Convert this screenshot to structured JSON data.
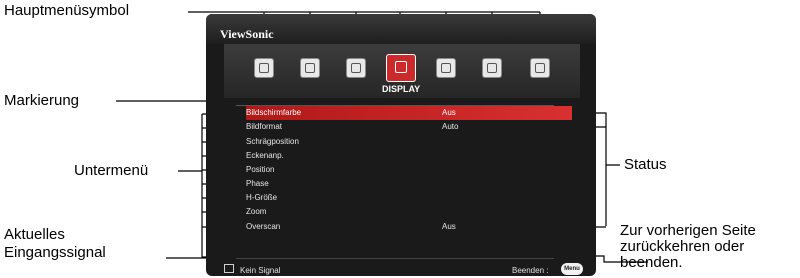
{
  "annotations": {
    "main_icon": "Hauptmenüsymbol",
    "highlight": "Markierung",
    "submenu": "Untermenü",
    "current_input_line1": "Aktuelles",
    "current_input_line2": "Eingangssignal",
    "status": "Status",
    "back_line1": "Zur vorherigen Seite",
    "back_line2": "zurückkehren oder",
    "back_line3": "beenden."
  },
  "osd": {
    "brand": "ViewSonic",
    "category": "DISPLAY",
    "icons": [
      "picture-icon",
      "color-icon",
      "lamp-icon",
      "display-icon",
      "settings-icon",
      "system-icon",
      "info-icon"
    ],
    "active_icon_index": 3,
    "items": [
      {
        "label": "Bildschirmfarbe",
        "value": "Aus"
      },
      {
        "label": "Bildformat",
        "value": "Auto"
      },
      {
        "label": "Schrägposition",
        "value": ""
      },
      {
        "label": "Eckenanp.",
        "value": ""
      },
      {
        "label": "Position",
        "value": ""
      },
      {
        "label": "Phase",
        "value": ""
      },
      {
        "label": "H-Größe",
        "value": ""
      },
      {
        "label": "Zoom",
        "value": ""
      },
      {
        "label": "Overscan",
        "value": "Aus"
      }
    ],
    "highlighted_index": 0,
    "footer": {
      "signal": "Kein Signal",
      "exit_label": "Beenden :",
      "menu_button": "Menu"
    },
    "accent_color": "#cc2a2a"
  }
}
